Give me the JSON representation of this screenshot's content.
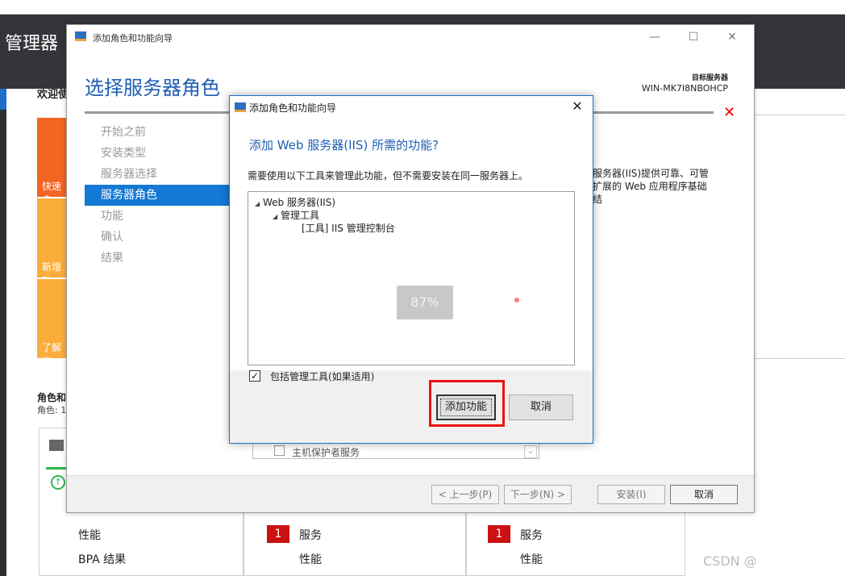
{
  "server_manager": {
    "title": "管理器",
    "welcome": "欢迎使",
    "tiles": [
      "快速启",
      "新增功",
      "了解详"
    ],
    "roles_heading": "角色和",
    "roles_sub": "角色: 1",
    "panel1": [
      "性能",
      "BPA 结果"
    ],
    "panel2": {
      "badge": "1",
      "service": "服务",
      "perf": "性能"
    },
    "panel3": {
      "badge": "1",
      "service": "服务",
      "perf": "性能"
    }
  },
  "wizard": {
    "window_title": "添加角色和功能向导",
    "heading": "选择服务器角色",
    "target_label": "目标服务器",
    "target_server": "WIN-MK7I8NBOHCP",
    "steps": [
      "开始之前",
      "安装类型",
      "服务器选择",
      "服务器角色",
      "功能",
      "确认",
      "结果"
    ],
    "description": "服务器(IIS)提供可靠、可管扩展的 Web 应用程序基础结",
    "list_row_text": "主机保护者服务",
    "buttons": {
      "prev": "< 上一步(P)",
      "next": "下一步(N) >",
      "install": "安装(I)",
      "cancel": "取消"
    }
  },
  "dialog": {
    "title": "添加角色和功能向导",
    "heading": "添加 Web 服务器(IIS) 所需的功能?",
    "text": "需要使用以下工具来管理此功能，但不需要安装在同一服务器上。",
    "tree": [
      "Web 服务器(IIS)",
      "管理工具",
      "[工具] IIS 管理控制台"
    ],
    "progress_text": "87%",
    "checkbox_label": "包括管理工具(如果适用)",
    "add_button": "添加功能",
    "cancel_button": "取消"
  },
  "watermark": "CSDN @"
}
